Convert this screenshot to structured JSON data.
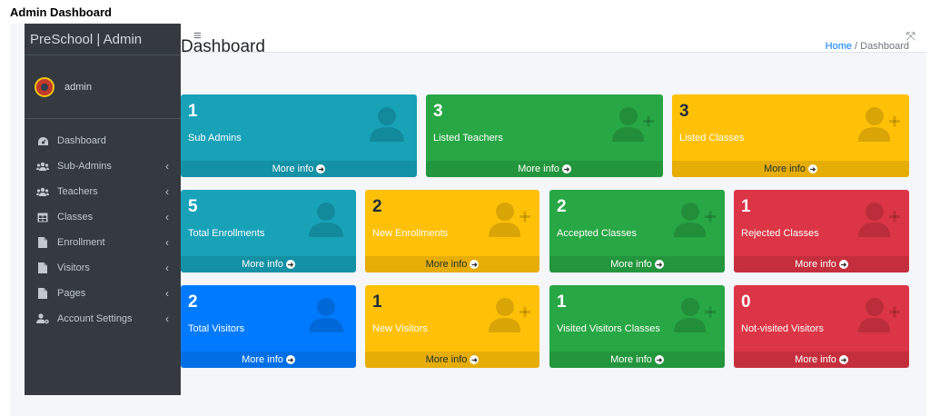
{
  "page_heading": "Admin Dashboard",
  "brand": "PreSchool | Admin",
  "user": {
    "name": "admin"
  },
  "sidebar": {
    "items": [
      {
        "label": "Dashboard",
        "icon": "dashboard-icon",
        "has_chevron": false
      },
      {
        "label": "Sub-Admins",
        "icon": "users-icon",
        "has_chevron": true
      },
      {
        "label": "Teachers",
        "icon": "users-icon",
        "has_chevron": true
      },
      {
        "label": "Classes",
        "icon": "table-icon",
        "has_chevron": true
      },
      {
        "label": "Enrollment",
        "icon": "file-icon",
        "has_chevron": true
      },
      {
        "label": "Visitors",
        "icon": "file-icon",
        "has_chevron": true
      },
      {
        "label": "Pages",
        "icon": "file-icon",
        "has_chevron": true
      },
      {
        "label": "Account Settings",
        "icon": "user-cog-icon",
        "has_chevron": true
      }
    ],
    "chevron": "‹"
  },
  "topbar": {
    "menu_glyph": "≡",
    "expand_glyph": "⤧"
  },
  "title": "Dashboard",
  "breadcrumb": {
    "home": "Home",
    "sep": "/",
    "current": "Dashboard"
  },
  "more_label": "More info",
  "cards": [
    {
      "value": "1",
      "label": "Sub Admins",
      "color": "info",
      "icon": "user-icon"
    },
    {
      "value": "3",
      "label": "Listed Teachers",
      "color": "success",
      "icon": "user-plus-icon"
    },
    {
      "value": "3",
      "label": "Listed Classes",
      "color": "warning",
      "icon": "user-plus-icon"
    },
    {
      "value": "5",
      "label": "Total Enrollments",
      "color": "info",
      "icon": "user-icon"
    },
    {
      "value": "2",
      "label": "New Enrollments",
      "color": "warning",
      "icon": "user-plus-icon"
    },
    {
      "value": "2",
      "label": "Accepted Classes",
      "color": "success",
      "icon": "user-plus-icon"
    },
    {
      "value": "1",
      "label": "Rejected Classes",
      "color": "danger",
      "icon": "user-plus-icon"
    },
    {
      "value": "2",
      "label": "Total Visitors",
      "color": "primary",
      "icon": "user-icon"
    },
    {
      "value": "1",
      "label": "New Visitors",
      "color": "warning",
      "icon": "user-plus-icon"
    },
    {
      "value": "1",
      "label": "Visited Visitors Classes",
      "color": "success",
      "icon": "user-plus-icon"
    },
    {
      "value": "0",
      "label": "Not-visited Visitors",
      "color": "danger",
      "icon": "user-plus-icon"
    }
  ],
  "colors": {
    "info": "#17a2b8",
    "success": "#28a745",
    "warning": "#ffc107",
    "danger": "#dc3545",
    "primary": "#007bff",
    "sidebar_bg": "#343a40"
  }
}
